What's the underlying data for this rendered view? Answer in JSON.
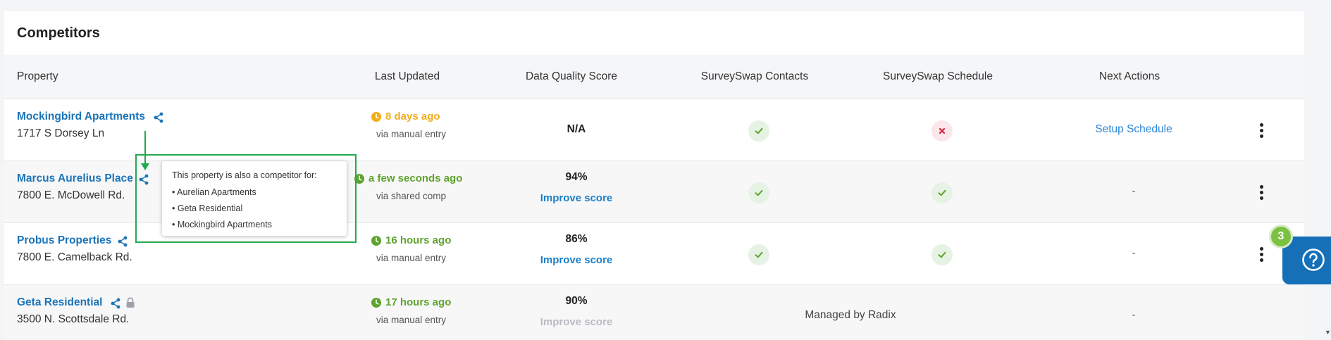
{
  "card": {
    "title": "Competitors"
  },
  "table": {
    "headers": {
      "property": "Property",
      "last_updated": "Last Updated",
      "data_quality": "Data Quality Score",
      "contacts": "SurveySwap Contacts",
      "schedule": "SurveySwap Schedule",
      "next_actions": "Next Actions"
    },
    "rows": [
      {
        "name": "Mockingbird Apartments",
        "address": "1717 S Dorsey Ln",
        "updated": "8 days ago",
        "updated_status": "amber",
        "via": "via manual entry",
        "score": "N/A",
        "improve": "",
        "contacts": "check",
        "schedule": "x",
        "next_action": "Setup Schedule"
      },
      {
        "name": "Marcus Aurelius Place",
        "address": "7800 E. McDowell Rd.",
        "updated": "a few seconds ago",
        "updated_status": "green",
        "via": "via shared comp",
        "score": "94%",
        "improve": "Improve score",
        "contacts": "check",
        "schedule": "check",
        "next_action": "-"
      },
      {
        "name": "Probus Properties",
        "address": "7800 E. Camelback Rd.",
        "updated": "16 hours ago",
        "updated_status": "green",
        "via": "via manual entry",
        "score": "86%",
        "improve": "Improve score",
        "contacts": "check",
        "schedule": "check",
        "next_action": "-"
      },
      {
        "name": "Geta Residential",
        "address": "3500 N. Scottsdale Rd.",
        "updated": "17 hours ago",
        "updated_status": "green",
        "via": "via manual entry",
        "score": "90%",
        "improve": "Improve score",
        "managed": "Managed by Radix",
        "next_action": "-"
      }
    ]
  },
  "tooltip": {
    "title": "This property is also a competitor for:",
    "items": [
      "Aurelian Apartments",
      "Geta Residential",
      "Mockingbird Apartments"
    ]
  },
  "help": {
    "badge": "3"
  },
  "colors": {
    "link": "#1b74b8",
    "amber": "#f3ad1a",
    "green": "#5ea32e",
    "annotation": "#22a94f",
    "help": "#1570b8"
  }
}
